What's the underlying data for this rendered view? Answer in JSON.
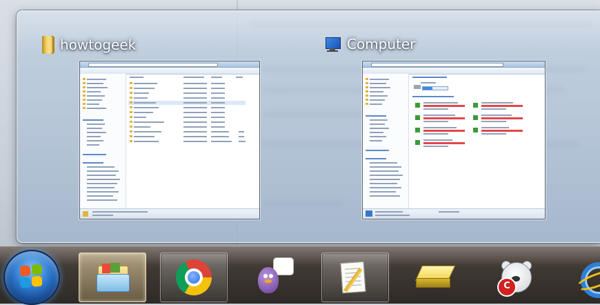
{
  "peek": {
    "groups": [
      {
        "title": "howtogeek",
        "icon": "folder-icon"
      },
      {
        "title": "Computer",
        "icon": "computer-icon"
      }
    ]
  },
  "taskbar": {
    "buttons": [
      {
        "name": "start-button",
        "icon": "windows-logo-icon",
        "state": "normal"
      },
      {
        "name": "taskbar-explorer-button",
        "icon": "windows-explorer-icon",
        "state": "active"
      },
      {
        "name": "taskbar-chrome-button",
        "icon": "chrome-icon",
        "state": "open"
      },
      {
        "name": "taskbar-pidgin-button",
        "icon": "pidgin-icon",
        "state": "normal"
      },
      {
        "name": "taskbar-notepad-button",
        "icon": "notepad-pencil-icon",
        "state": "open"
      },
      {
        "name": "taskbar-drive-tool-button",
        "icon": "yellow-drive-icon",
        "state": "normal"
      },
      {
        "name": "taskbar-bear-app-button",
        "icon": "polar-bear-icon",
        "state": "normal"
      },
      {
        "name": "taskbar-ie-button",
        "icon": "internet-explorer-icon",
        "state": "normal"
      }
    ],
    "badge_letter": "C"
  },
  "colors": {
    "accent_blue": "#2a74c9",
    "peek_panel": "#b0c2d6",
    "taskbar": "#3f3832"
  }
}
